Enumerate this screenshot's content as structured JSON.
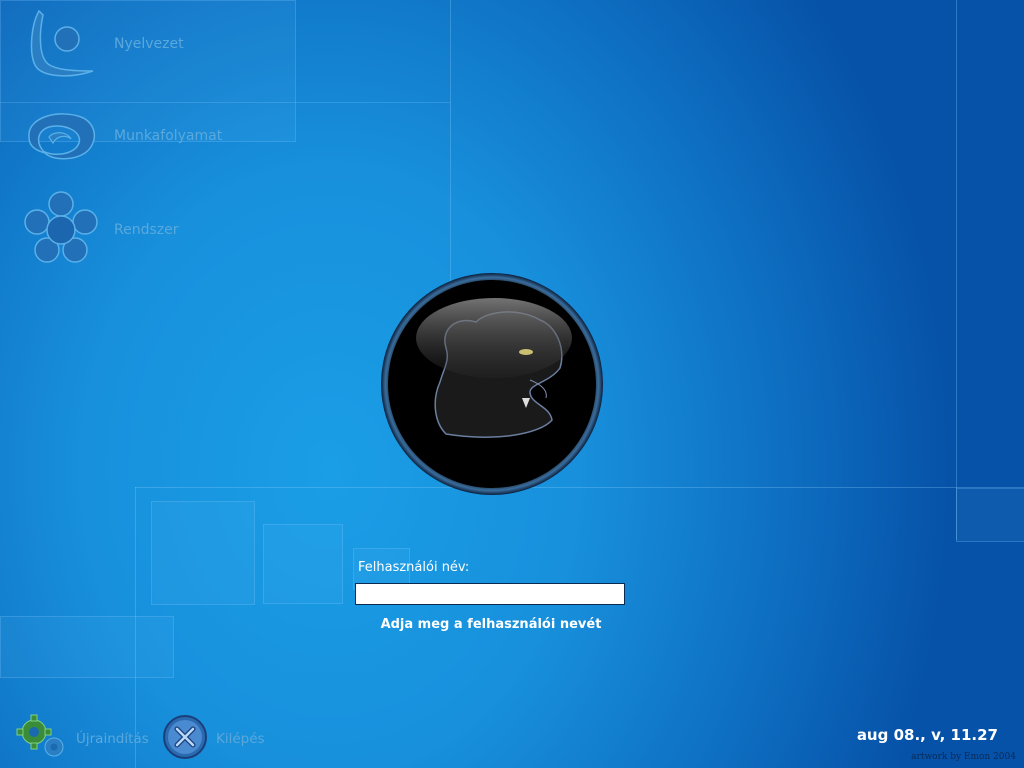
{
  "sidebar": {
    "items": [
      {
        "label": "Nyelvezet",
        "icon": "language-icon"
      },
      {
        "label": "Munkafolyamat",
        "icon": "session-icon"
      },
      {
        "label": "Rendszer",
        "icon": "system-icon"
      }
    ]
  },
  "logo": {
    "icon": "panther-logo-icon"
  },
  "login": {
    "username_label": "Felhasználói név:",
    "username_value": "",
    "hint": "Adja meg a felhasználói nevét"
  },
  "bottom": {
    "restart_label": "Újraindítás",
    "restart_icon": "gear-icon",
    "quit_label": "Kilépés",
    "quit_icon": "close-icon"
  },
  "clock": "aug 08., v, 11.27",
  "credit": "artwork by Emon 2004",
  "colors": {
    "accent_text": "#5aa8dc",
    "background": "#1890dc"
  }
}
